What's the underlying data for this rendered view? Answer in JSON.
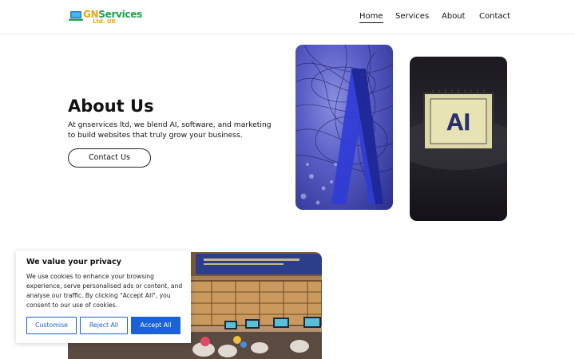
{
  "header": {
    "logo_main": "GNServices",
    "logo_sub": "Ltd. UK",
    "nav": [
      "Home",
      "Services",
      "About",
      "Contact"
    ]
  },
  "hero": {
    "title": "About Us",
    "description": "At gnservices ltd, we blend AI, software, and marketing to build websites that truly grow your business.",
    "contact_label": "Contact Us"
  },
  "images": {
    "chip_text": "AI"
  },
  "cookie": {
    "title": "We value your privacy",
    "text": "We use cookies to enhance your browsing experience, serve personalised ads or content, and analyse our traffic. By clicking \"Accept All\", you consent to our use of cookies.",
    "customise_label": "Customise",
    "reject_label": "Reject All",
    "accept_label": "Accept All"
  },
  "colors": {
    "accent": "#1a62d6",
    "logo_green": "#1aa34a",
    "logo_orange": "#f0a010"
  }
}
